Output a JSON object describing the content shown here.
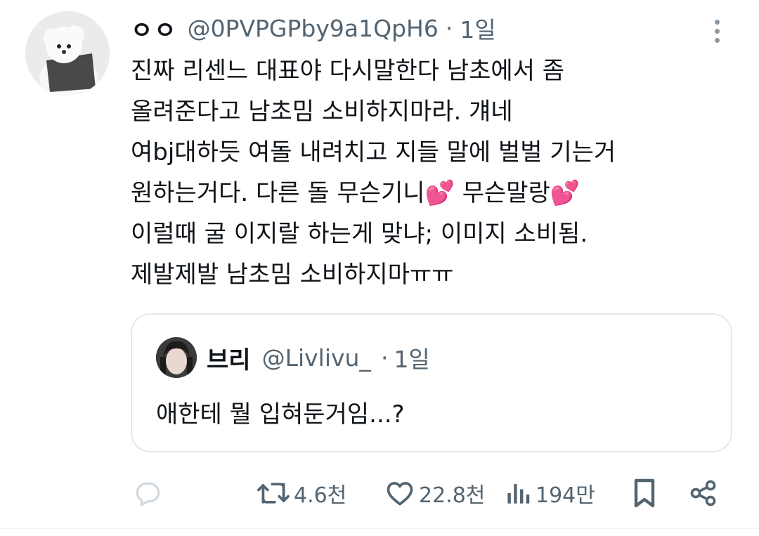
{
  "tweet": {
    "display_name": "ㅇㅇ",
    "handle": "@0PVPGPby9a1QpH6",
    "separator": "·",
    "time": "1일",
    "text_lines": [
      "진짜 리센느 대표야 다시말한다 남초에서 좀",
      "올려준다고 남초밈 소비하지마라. 걔네",
      "여bj대하듯 여돌 내려치고 지들 말에 벌벌 기는거",
      "원하는거다. 다른 돌 무슨기니💕 무슨말랑💕",
      "이럴때 굴 이지랄 하는게 맞냐; 이미지 소비됨.",
      "제발제발 남초밈 소비하지마ㅠㅠ"
    ]
  },
  "quoted_tweet": {
    "display_name": "브리",
    "handle": "@Livlivu_",
    "separator": "·",
    "time": "1일",
    "text": "애한테 뭘 입혀둔거임...?"
  },
  "actions": {
    "retweets": "4.6천",
    "likes": "22.8천",
    "views": "194만"
  },
  "icons": [
    "reply-icon",
    "retweet-icon",
    "like-icon",
    "views-icon",
    "bookmark-icon",
    "share-icon",
    "more-icon"
  ],
  "colors": {
    "text": "#0f1419",
    "secondary": "#536471",
    "border": "#e5e8eb"
  }
}
